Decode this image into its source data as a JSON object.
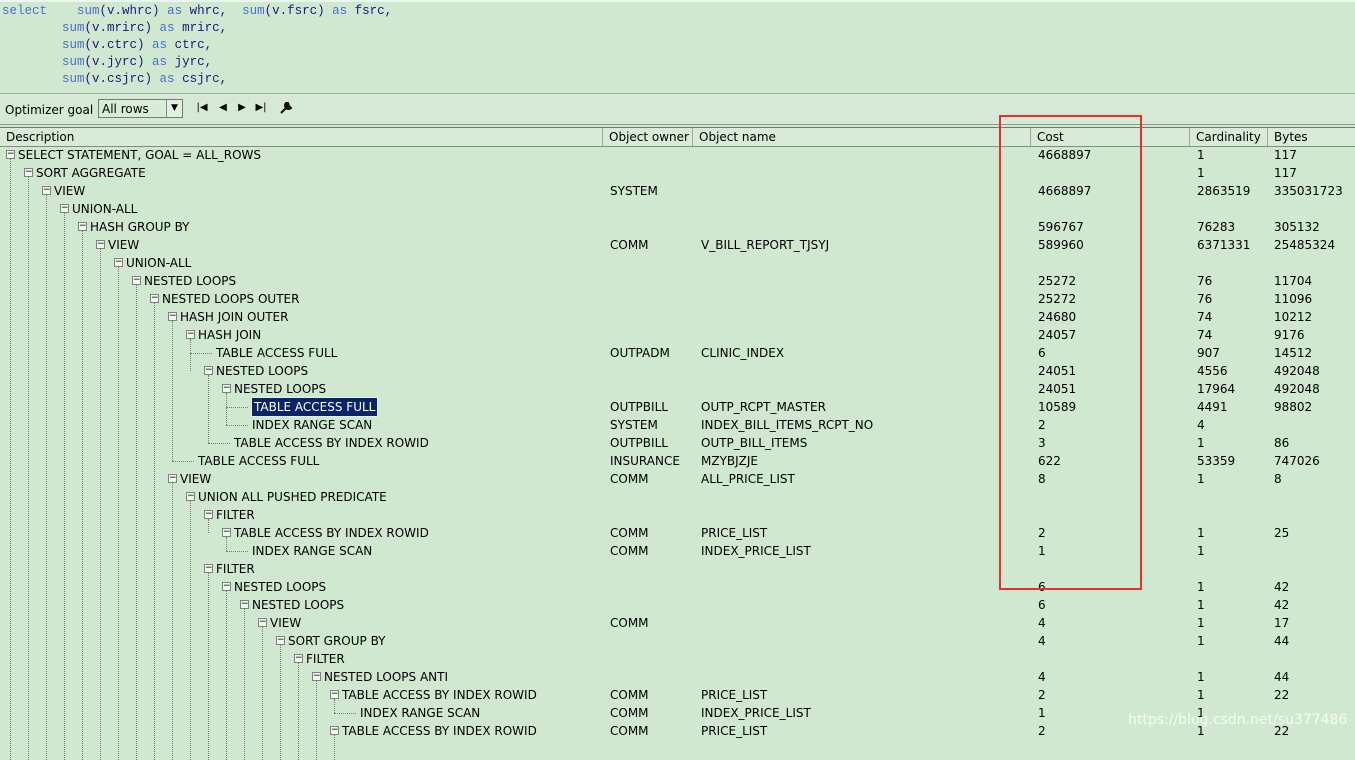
{
  "sql": {
    "lines": [
      [
        {
          "t": "select",
          "c": "kw"
        },
        {
          "t": "    "
        },
        {
          "t": "sum",
          "c": "fn"
        },
        {
          "t": "(v.whrc) "
        },
        {
          "t": "as",
          "c": "kw"
        },
        {
          "t": " whrc,  "
        },
        {
          "t": "sum",
          "c": "fn"
        },
        {
          "t": "(v.fsrc) "
        },
        {
          "t": "as",
          "c": "kw"
        },
        {
          "t": " fsrc,"
        }
      ],
      [
        {
          "t": "        "
        },
        {
          "t": "sum",
          "c": "fn"
        },
        {
          "t": "(v.mrirc) "
        },
        {
          "t": "as",
          "c": "kw"
        },
        {
          "t": " mrirc,"
        }
      ],
      [
        {
          "t": "        "
        },
        {
          "t": "sum",
          "c": "fn"
        },
        {
          "t": "(v.ctrc) "
        },
        {
          "t": "as",
          "c": "kw"
        },
        {
          "t": " ctrc,"
        }
      ],
      [
        {
          "t": "        "
        },
        {
          "t": "sum",
          "c": "fn"
        },
        {
          "t": "(v.jyrc) "
        },
        {
          "t": "as",
          "c": "kw"
        },
        {
          "t": " jyrc,"
        }
      ],
      [
        {
          "t": "        "
        },
        {
          "t": "sum",
          "c": "fn"
        },
        {
          "t": "(v.csjrc) "
        },
        {
          "t": "as",
          "c": "kw"
        },
        {
          "t": " csjrc,"
        }
      ]
    ]
  },
  "toolbar": {
    "optimizer_label": "Optimizer goal",
    "optimizer_value": "All rows",
    "dropdown_icon": "chevron-down-icon",
    "nav": [
      "first-icon",
      "prev-icon",
      "next-icon",
      "last-icon",
      "wrench-icon"
    ]
  },
  "columns": {
    "description": "Description",
    "owner": "Object owner",
    "name": "Object name",
    "cost": "Cost",
    "cardinality": "Cardinality",
    "bytes": "Bytes"
  },
  "rows": [
    {
      "d": 0,
      "desc": "SELECT STATEMENT, GOAL = ALL_ROWS",
      "owner": "",
      "name": "",
      "cost": "4668897",
      "card": "1",
      "bytes": "117",
      "exp": true
    },
    {
      "d": 1,
      "desc": "SORT AGGREGATE",
      "owner": "",
      "name": "",
      "cost": "",
      "card": "1",
      "bytes": "117",
      "exp": true
    },
    {
      "d": 2,
      "desc": "VIEW",
      "owner": "SYSTEM",
      "name": "",
      "cost": "4668897",
      "card": "2863519",
      "bytes": "335031723",
      "exp": true
    },
    {
      "d": 3,
      "desc": "UNION-ALL",
      "owner": "",
      "name": "",
      "cost": "",
      "card": "",
      "bytes": "",
      "exp": true
    },
    {
      "d": 4,
      "desc": "HASH GROUP BY",
      "owner": "",
      "name": "",
      "cost": "596767",
      "card": "76283",
      "bytes": "305132",
      "exp": true
    },
    {
      "d": 5,
      "desc": "VIEW",
      "owner": "COMM",
      "name": "V_BILL_REPORT_TJSYJ",
      "cost": "589960",
      "card": "6371331",
      "bytes": "25485324",
      "exp": true
    },
    {
      "d": 6,
      "desc": "UNION-ALL",
      "owner": "",
      "name": "",
      "cost": "",
      "card": "",
      "bytes": "",
      "exp": true
    },
    {
      "d": 7,
      "desc": "NESTED LOOPS",
      "owner": "",
      "name": "",
      "cost": "25272",
      "card": "76",
      "bytes": "11704",
      "exp": true
    },
    {
      "d": 8,
      "desc": "NESTED LOOPS OUTER",
      "owner": "",
      "name": "",
      "cost": "25272",
      "card": "76",
      "bytes": "11096",
      "exp": true
    },
    {
      "d": 9,
      "desc": "HASH JOIN OUTER",
      "owner": "",
      "name": "",
      "cost": "24680",
      "card": "74",
      "bytes": "10212",
      "exp": true
    },
    {
      "d": 10,
      "desc": "HASH JOIN",
      "owner": "",
      "name": "",
      "cost": "24057",
      "card": "74",
      "bytes": "9176",
      "exp": true
    },
    {
      "d": 11,
      "desc": "TABLE ACCESS FULL",
      "owner": "OUTPADM",
      "name": "CLINIC_INDEX",
      "cost": "6",
      "card": "907",
      "bytes": "14512",
      "exp": false
    },
    {
      "d": 11,
      "desc": "NESTED LOOPS",
      "owner": "",
      "name": "",
      "cost": "24051",
      "card": "4556",
      "bytes": "492048",
      "exp": true
    },
    {
      "d": 12,
      "desc": "NESTED LOOPS",
      "owner": "",
      "name": "",
      "cost": "24051",
      "card": "17964",
      "bytes": "492048",
      "exp": true
    },
    {
      "d": 13,
      "desc": "TABLE ACCESS FULL",
      "owner": "OUTPBILL",
      "name": "OUTP_RCPT_MASTER",
      "cost": "10589",
      "card": "4491",
      "bytes": "98802",
      "exp": false,
      "sel": true
    },
    {
      "d": 13,
      "desc": "INDEX RANGE SCAN",
      "owner": "SYSTEM",
      "name": "INDEX_BILL_ITEMS_RCPT_NO",
      "cost": "2",
      "card": "4",
      "bytes": "",
      "exp": false
    },
    {
      "d": 12,
      "desc": "TABLE ACCESS BY INDEX ROWID",
      "owner": "OUTPBILL",
      "name": "OUTP_BILL_ITEMS",
      "cost": "3",
      "card": "1",
      "bytes": "86",
      "exp": false
    },
    {
      "d": 10,
      "desc": "TABLE ACCESS FULL",
      "owner": "INSURANCE",
      "name": "MZYBJZJE",
      "cost": "622",
      "card": "53359",
      "bytes": "747026",
      "exp": false
    },
    {
      "d": 9,
      "desc": "VIEW",
      "owner": "COMM",
      "name": "ALL_PRICE_LIST",
      "cost": "8",
      "card": "1",
      "bytes": "8",
      "exp": true
    },
    {
      "d": 10,
      "desc": "UNION ALL PUSHED PREDICATE",
      "owner": "",
      "name": "",
      "cost": "",
      "card": "",
      "bytes": "",
      "exp": true
    },
    {
      "d": 11,
      "desc": "FILTER",
      "owner": "",
      "name": "",
      "cost": "",
      "card": "",
      "bytes": "",
      "exp": true
    },
    {
      "d": 12,
      "desc": "TABLE ACCESS BY INDEX ROWID",
      "owner": "COMM",
      "name": "PRICE_LIST",
      "cost": "2",
      "card": "1",
      "bytes": "25",
      "exp": true
    },
    {
      "d": 13,
      "desc": "INDEX RANGE SCAN",
      "owner": "COMM",
      "name": "INDEX_PRICE_LIST",
      "cost": "1",
      "card": "1",
      "bytes": "",
      "exp": false
    },
    {
      "d": 11,
      "desc": "FILTER",
      "owner": "",
      "name": "",
      "cost": "",
      "card": "",
      "bytes": "",
      "exp": true
    },
    {
      "d": 12,
      "desc": "NESTED LOOPS",
      "owner": "",
      "name": "",
      "cost": "6",
      "card": "1",
      "bytes": "42",
      "exp": true
    },
    {
      "d": 13,
      "desc": "NESTED LOOPS",
      "owner": "",
      "name": "",
      "cost": "6",
      "card": "1",
      "bytes": "42",
      "exp": true
    },
    {
      "d": 14,
      "desc": "VIEW",
      "owner": "COMM",
      "name": "",
      "cost": "4",
      "card": "1",
      "bytes": "17",
      "exp": true
    },
    {
      "d": 15,
      "desc": "SORT GROUP BY",
      "owner": "",
      "name": "",
      "cost": "4",
      "card": "1",
      "bytes": "44",
      "exp": true
    },
    {
      "d": 16,
      "desc": "FILTER",
      "owner": "",
      "name": "",
      "cost": "",
      "card": "",
      "bytes": "",
      "exp": true
    },
    {
      "d": 17,
      "desc": "NESTED LOOPS ANTI",
      "owner": "",
      "name": "",
      "cost": "4",
      "card": "1",
      "bytes": "44",
      "exp": true
    },
    {
      "d": 18,
      "desc": "TABLE ACCESS BY INDEX ROWID",
      "owner": "COMM",
      "name": "PRICE_LIST",
      "cost": "2",
      "card": "1",
      "bytes": "22",
      "exp": true
    },
    {
      "d": 19,
      "desc": "INDEX RANGE SCAN",
      "owner": "COMM",
      "name": "INDEX_PRICE_LIST",
      "cost": "1",
      "card": "1",
      "bytes": "",
      "exp": false
    },
    {
      "d": 18,
      "desc": "TABLE ACCESS BY INDEX ROWID",
      "owner": "COMM",
      "name": "PRICE_LIST",
      "cost": "2",
      "card": "1",
      "bytes": "22",
      "exp": true
    }
  ],
  "watermark": "https://blog.csdn.net/su377486",
  "colors": {
    "background": "#cfe8cf",
    "highlight_box": "#e8302a",
    "selection": "#0a246a"
  }
}
